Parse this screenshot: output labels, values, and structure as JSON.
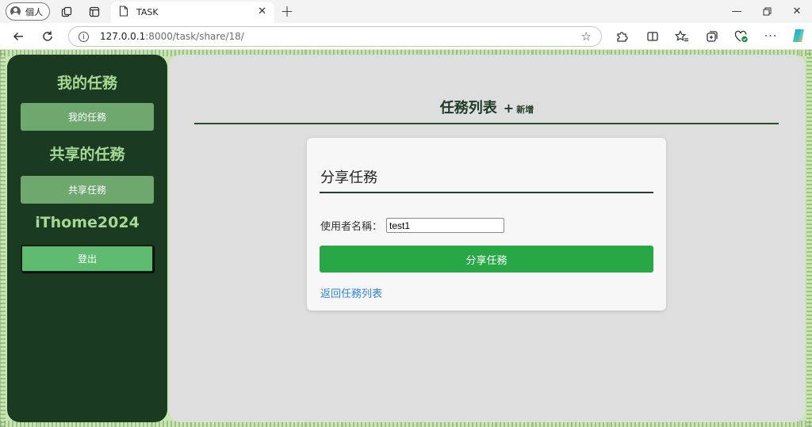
{
  "browser": {
    "profile_label": "個人",
    "tab_title": "TASK",
    "url_host": "127.0.0.1",
    "url_path": ":8000/task/share/18/"
  },
  "sidebar": {
    "heading_my_tasks": "我的任務",
    "btn_my_tasks": "我的任務",
    "heading_shared": "共享的任務",
    "btn_shared": "共享任務",
    "heading_brand": "iThome2024",
    "btn_logout": "登出"
  },
  "main": {
    "title": "任務列表",
    "add_label": "新增",
    "add_symbol": "+"
  },
  "card": {
    "title": "分享任務",
    "username_label": "使用者名稱：",
    "username_value": "test1",
    "submit_label": "分享任務",
    "back_label": "返回任務列表"
  },
  "colors": {
    "sidebar_bg": "#1b3a22",
    "sidebar_heading": "#a6d894",
    "sidebar_button": "#6fa86e",
    "submit_button": "#27a745",
    "link": "#2f83d8",
    "page_bg": "#c9e6b1"
  },
  "icons": {
    "profile": "person-icon",
    "workspaces": "workspaces-icon",
    "tab_actions": "tab-actions-icon",
    "page": "document-icon",
    "back": "arrow-left-icon",
    "refresh": "refresh-icon",
    "info": "info-icon",
    "favorite": "star-icon",
    "extensions": "puzzle-icon",
    "split": "split-screen-icon",
    "favorites": "favorites-icon",
    "collections": "collections-icon",
    "health": "browser-essentials-icon",
    "more": "more-icon",
    "copilot": "copilot-icon"
  }
}
